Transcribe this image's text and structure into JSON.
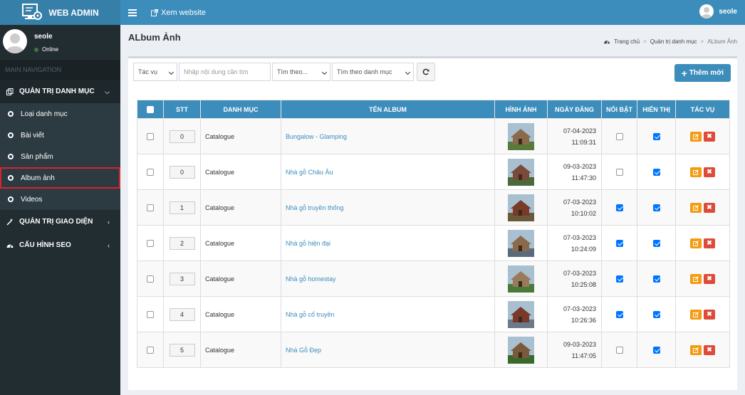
{
  "app": {
    "title": "WEB ADMIN"
  },
  "topbar": {
    "view_site": "Xem website",
    "user_name": "seole"
  },
  "sidebar": {
    "user": {
      "name": "seole",
      "status": "Online"
    },
    "nav_header": "MAIN NAVIGATION",
    "groups": [
      {
        "label": "QUẢN TRỊ DANH MỤC",
        "items": [
          {
            "label": "Loại danh mục"
          },
          {
            "label": "Bài viết"
          },
          {
            "label": "Sản phẩm"
          },
          {
            "label": "Album ảnh"
          },
          {
            "label": "Videos"
          }
        ]
      },
      {
        "label": "QUẢN TRỊ GIAO DIỆN"
      },
      {
        "label": "CẤU HÌNH SEO"
      }
    ]
  },
  "page": {
    "title": "ALbum Ảnh",
    "breadcrumb": [
      "Trang chủ",
      "Quản trị danh mục",
      "ALbum Ảnh"
    ]
  },
  "toolbar": {
    "action_select": "Tác vụ",
    "search_placeholder": "Nhập nội dung cần tìm",
    "search_by": "Tìm theo...",
    "category_filter": "Tìm theo danh mục",
    "add_button": "Thêm mới"
  },
  "table": {
    "headers": [
      "STT",
      "DANH MỤC",
      "TÊN ALBUM",
      "HÌNH ẢNH",
      "NGÀY ĐĂNG",
      "NỔI BẬT",
      "HIỂN THỊ",
      "TÁC VỤ"
    ],
    "rows": [
      {
        "stt": "0",
        "category": "Catalogue",
        "name": "Bungalow - Glamping",
        "date": "07-04-2023",
        "time": "11:09:31",
        "featured": false,
        "visible": true
      },
      {
        "stt": "0",
        "category": "Catalogue",
        "name": "Nhà gỗ Châu Âu",
        "date": "09-03-2023",
        "time": "11:47:30",
        "featured": false,
        "visible": true
      },
      {
        "stt": "1",
        "category": "Catalogue",
        "name": "Nhà gỗ truyền thống",
        "date": "07-03-2023",
        "time": "10:10:02",
        "featured": true,
        "visible": true
      },
      {
        "stt": "2",
        "category": "Catalogue",
        "name": "Nhà gỗ hiện đại",
        "date": "07-03-2023",
        "time": "10:24:09",
        "featured": true,
        "visible": true
      },
      {
        "stt": "3",
        "category": "Catalogue",
        "name": "Nhà gỗ homestay",
        "date": "07-03-2023",
        "time": "10:25:08",
        "featured": true,
        "visible": true
      },
      {
        "stt": "4",
        "category": "Catalogue",
        "name": "Nhà gỗ cổ truyền",
        "date": "07-03-2023",
        "time": "10:26:36",
        "featured": true,
        "visible": true
      },
      {
        "stt": "5",
        "category": "Catalogue",
        "name": "Nhà Gỗ Đẹp",
        "date": "09-03-2023",
        "time": "11:47:05",
        "featured": false,
        "visible": true
      }
    ]
  },
  "colors": {
    "header": "#3c8dbc",
    "sidebar": "#222d32",
    "edit": "#f39c12",
    "delete": "#dd4b39",
    "highlight": "#d9232d"
  }
}
